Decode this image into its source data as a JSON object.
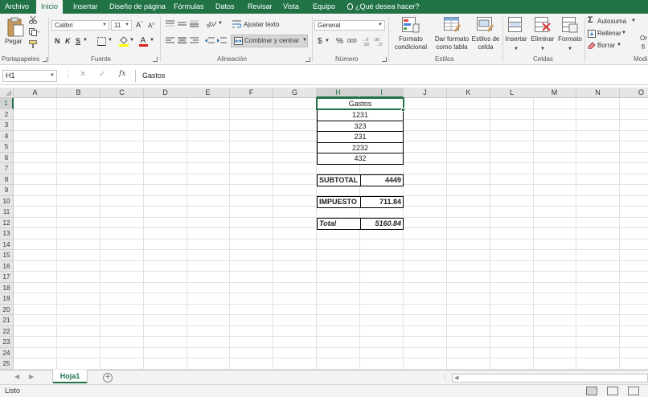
{
  "tabs": [
    {
      "label": "Archivo",
      "active": false
    },
    {
      "label": "Inicio",
      "active": true
    },
    {
      "label": "Insertar",
      "active": false
    },
    {
      "label": "Diseño de página",
      "active": false
    },
    {
      "label": "Fórmulas",
      "active": false
    },
    {
      "label": "Datos",
      "active": false
    },
    {
      "label": "Revisar",
      "active": false
    },
    {
      "label": "Vista",
      "active": false
    },
    {
      "label": "Equipo",
      "active": false
    }
  ],
  "tell_me": "¿Qué desea hacer?",
  "ribbon": {
    "clipboard": {
      "paste_label": "Pegar",
      "group_label": "Portapapeles"
    },
    "font": {
      "name": "Calibri",
      "size": "11",
      "group_label": "Fuente",
      "bold": "N",
      "italic": "K",
      "underline": "S"
    },
    "alignment": {
      "wrap_label": "Ajustar texto",
      "merge_label": "Combinar y centrar",
      "group_label": "Alineación"
    },
    "number": {
      "format": "General",
      "currency": "$",
      "percent": "%",
      "thousands": "000",
      "group_label": "Número"
    },
    "styles": {
      "conditional_label_1": "Formato",
      "conditional_label_2": "condicional",
      "table_label_1": "Dar formato",
      "table_label_2": "como tabla",
      "cell_styles_label_1": "Estilos de",
      "cell_styles_label_2": "celda",
      "group_label": "Estilos"
    },
    "cells": {
      "insert_label": "Insertar",
      "delete_label": "Eliminar",
      "format_label": "Formato",
      "group_label": "Celdas"
    },
    "editing": {
      "autosum_label": "Autosuma",
      "fill_label": "Rellenar",
      "clear_label": "Borrar",
      "group_label": "Modi",
      "extra_label_1": "Or",
      "extra_label_2": "fi"
    }
  },
  "formula_bar": {
    "name_box": "H1",
    "fx": "fx",
    "content": "Gastos"
  },
  "columns": [
    "A",
    "B",
    "C",
    "D",
    "E",
    "F",
    "G",
    "H",
    "I",
    "J",
    "K",
    "L",
    "M",
    "N",
    "O"
  ],
  "rows": [
    "1",
    "2",
    "3",
    "4",
    "5",
    "6",
    "7",
    "8",
    "9",
    "10",
    "11",
    "12",
    "13",
    "14",
    "15",
    "16",
    "17",
    "18",
    "19",
    "20",
    "21",
    "22",
    "23",
    "24",
    "25"
  ],
  "cells": {
    "header": "Gastos",
    "expenses": [
      "1231",
      "323",
      "231",
      "2232",
      "432"
    ],
    "subtotal_label": "SUBTOTAL",
    "subtotal_value": "4449",
    "tax_label": "IMPUESTO",
    "tax_value": "711.84",
    "total_label": "Total",
    "total_value": "5160.84"
  },
  "sheets": [
    {
      "name": "Hoja1",
      "active": true
    }
  ],
  "status": {
    "text": "Listo"
  },
  "colors": {
    "accent": "#217346",
    "tab_text": "#ffffff",
    "ribbon_bg": "#f3f3f3"
  }
}
